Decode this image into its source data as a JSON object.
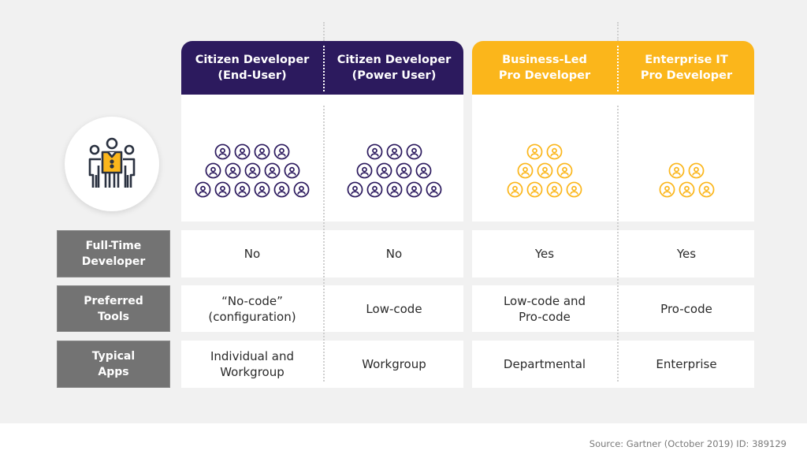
{
  "columns": [
    {
      "title": "Citizen Developer (End-User)",
      "line1": "Citizen Developer",
      "line2": "(End-User)",
      "group": "citizen",
      "icon_rows": [
        4,
        5,
        6
      ]
    },
    {
      "title": "Citizen Developer (Power User)",
      "line1": "Citizen Developer",
      "line2": "(Power User)",
      "group": "citizen",
      "icon_rows": [
        3,
        4,
        5
      ]
    },
    {
      "title": "Business-Led Pro Developer",
      "line1": "Business-Led",
      "line2": "Pro Developer",
      "group": "pro",
      "icon_rows": [
        2,
        3,
        4
      ]
    },
    {
      "title": "Enterprise IT Pro Developer",
      "line1": "Enterprise IT",
      "line2": "Pro Developer",
      "group": "pro",
      "icon_rows": [
        2,
        3
      ]
    }
  ],
  "group_colors": {
    "citizen": "#2c1a5e",
    "pro": "#fbb61b"
  },
  "people_icon": "people-group-icon",
  "person_icon": "person-circle-icon",
  "rows": [
    {
      "label_line1": "Full-Time",
      "label_line2": "Developer",
      "cells": [
        {
          "l1": "No",
          "l2": ""
        },
        {
          "l1": "No",
          "l2": ""
        },
        {
          "l1": "Yes",
          "l2": ""
        },
        {
          "l1": "Yes",
          "l2": ""
        }
      ]
    },
    {
      "label_line1": "Preferred",
      "label_line2": "Tools",
      "cells": [
        {
          "l1": "“No-code”",
          "l2": "(configuration)"
        },
        {
          "l1": "Low-code",
          "l2": ""
        },
        {
          "l1": "Low-code and",
          "l2": "Pro-code"
        },
        {
          "l1": "Pro-code",
          "l2": ""
        }
      ]
    },
    {
      "label_line1": "Typical",
      "label_line2": "Apps",
      "cells": [
        {
          "l1": "Individual and",
          "l2": "Workgroup"
        },
        {
          "l1": "Workgroup",
          "l2": ""
        },
        {
          "l1": "Departmental",
          "l2": ""
        },
        {
          "l1": "Enterprise",
          "l2": ""
        }
      ]
    }
  ],
  "source": "Source: Gartner (October 2019) ID: 389129"
}
